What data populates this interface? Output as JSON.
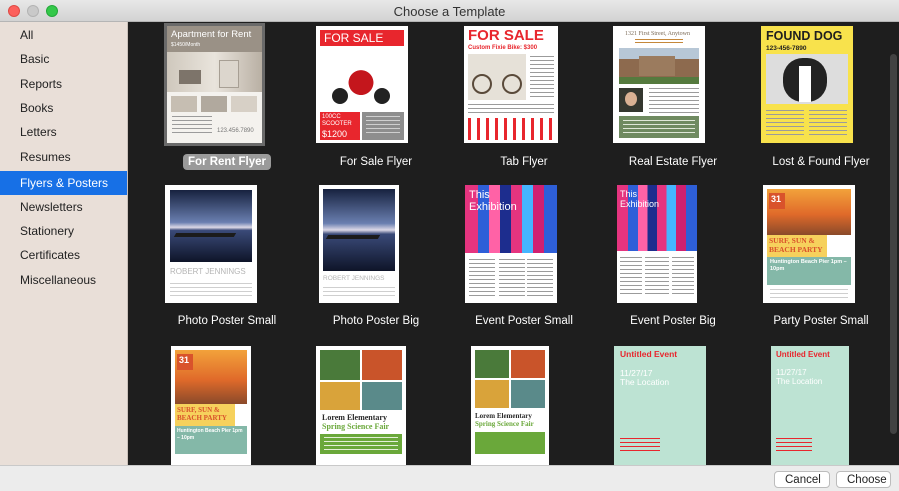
{
  "window": {
    "title": "Choose a Template"
  },
  "sidebar": {
    "items": [
      {
        "label": "All"
      },
      {
        "label": "Basic"
      },
      {
        "label": "Reports"
      },
      {
        "label": "Books"
      },
      {
        "label": "Letters"
      },
      {
        "label": "Resumes"
      },
      {
        "label": "Flyers & Posters",
        "selected": true
      },
      {
        "label": "Newsletters"
      },
      {
        "label": "Stationery"
      },
      {
        "label": "Certificates"
      },
      {
        "label": "Miscellaneous"
      }
    ]
  },
  "templates": [
    {
      "label": "For Rent Flyer",
      "selected": true,
      "thumb": {
        "headline": "Apartment for Rent",
        "sub": "$1450/Month",
        "phone": "123.456.7890"
      }
    },
    {
      "label": "For Sale Flyer",
      "thumb": {
        "headline": "FOR SALE",
        "item": "100CC SCOOTER",
        "price": "$1200"
      }
    },
    {
      "label": "Tab Flyer",
      "thumb": {
        "headline": "FOR SALE",
        "sub": "Custom Fixie Bike: $300"
      }
    },
    {
      "label": "Real Estate Flyer",
      "thumb": {
        "address": "1321 First Street, Anytown"
      }
    },
    {
      "label": "Lost & Found Flyer",
      "thumb": {
        "headline": "FOUND DOG",
        "phone": "123-456-7890"
      }
    },
    {
      "label": "Photo Poster Small",
      "thumb": {
        "name": "ROBERT JENNINGS"
      }
    },
    {
      "label": "Photo Poster Big",
      "thumb": {
        "name": "ROBERT JENNINGS"
      }
    },
    {
      "label": "Event Poster Small",
      "thumb": {
        "headline": "This Exhibition"
      }
    },
    {
      "label": "Event Poster Big",
      "thumb": {
        "headline": "This Exhibition"
      }
    },
    {
      "label": "Party Poster Small",
      "thumb": {
        "day": "31",
        "headline": "SURF, SUN & BEACH PARTY",
        "sub": "Huntington Beach Pier 1pm – 10pm"
      }
    },
    {
      "label": "",
      "thumb": {
        "day": "31",
        "headline": "SURF, SUN & BEACH PARTY",
        "sub": "Huntington Beach Pier 1pm – 10pm"
      }
    },
    {
      "label": "",
      "thumb": {
        "school": "Lorem Elementary",
        "event": "Spring Science Fair"
      }
    },
    {
      "label": "",
      "thumb": {
        "school": "Lorem Elementary",
        "event": "Spring Science Fair"
      }
    },
    {
      "label": "",
      "thumb": {
        "title": "Untitled Event",
        "date": "11/27/17",
        "location": "The Location"
      }
    },
    {
      "label": "",
      "thumb": {
        "title": "Untitled Event",
        "date": "11/27/17",
        "location": "The Location"
      }
    }
  ],
  "footer": {
    "cancel_label": "Cancel",
    "choose_label": "Choose"
  },
  "colors": {
    "selection": "#1770e6",
    "gallery_bg": "#1e1e1e",
    "sidebar_bg": "#e9dfd8",
    "mint": "#bde3d3",
    "party_teal": "#84b8a8"
  }
}
